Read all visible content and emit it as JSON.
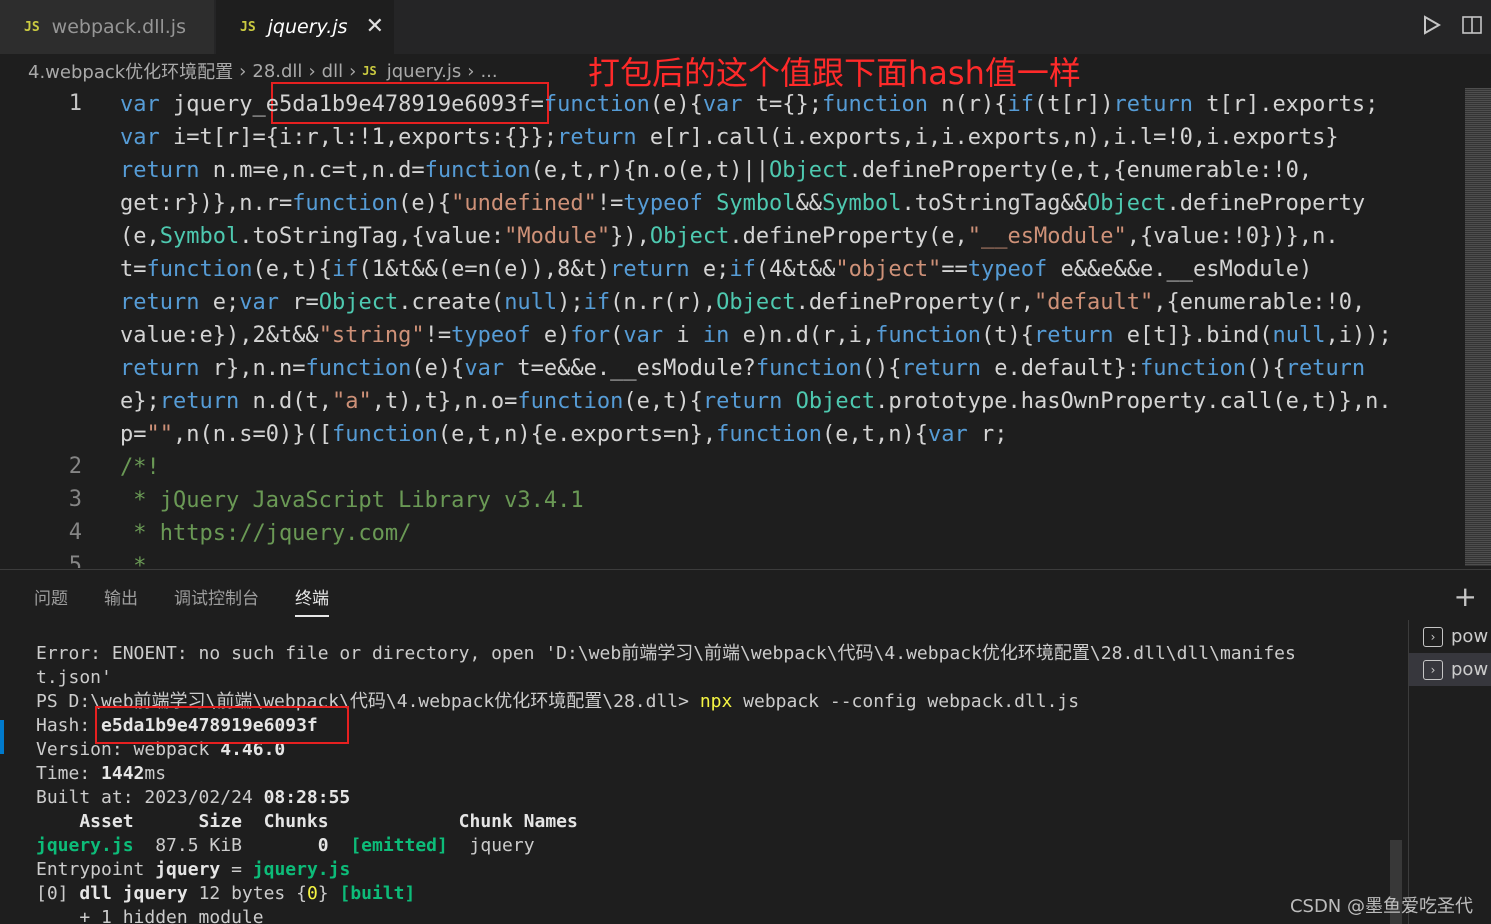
{
  "tabs": [
    {
      "icon": "JS",
      "label": "webpack.dll.js"
    },
    {
      "icon": "JS",
      "label": "jquery.js",
      "close": "✕"
    }
  ],
  "breadcrumb": [
    "4.webpack优化环境配置",
    "28.dll",
    "dll",
    "jquery.js",
    "..."
  ],
  "annotation": "打包后的这个值跟下面hash值一样",
  "editor": {
    "line_numbers": [
      "1",
      "2",
      "3",
      "4",
      "5"
    ],
    "line1": [
      "var jquery_e5da1b9e478919e6093f=function(e){var t={};function n(r){if(t[r])return t[r].exports;",
      "var i=t[r]={i:r,l:!1,exports:{}};return e[r].call(i.exports,i,i.exports,n),i.l=!0,i.exports}",
      "return n.m=e,n.c=t,n.d=function(e,t,r){n.o(e,t)||Object.defineProperty(e,t,{enumerable:!0,",
      "get:r})},n.r=function(e){\"undefined\"!=typeof Symbol&&Symbol.toStringTag&&Object.defineProperty",
      "(e,Symbol.toStringTag,{value:\"Module\"}),Object.defineProperty(e,\"__esModule\",{value:!0})},n.",
      "t=function(e,t){if(1&t&&(e=n(e)),8&t)return e;if(4&t&&\"object\"==typeof e&&e&&e.__esModule)",
      "return e;var r=Object.create(null);if(n.r(r),Object.defineProperty(r,\"default\",{enumerable:!0,",
      "value:e}),2&t&&\"string\"!=typeof e)for(var i in e)n.d(r,i,function(t){return e[t]}.bind(null,i));",
      "return r},n.n=function(e){var t=e&&e.__esModule?function(){return e.default}:function(){return",
      "e};return n.d(t,\"a\",t),t},n.o=function(e,t){return Object.prototype.hasOwnProperty.call(e,t)},n.",
      "p=\"\",n(n.s=0)}([function(e,t,n){e.exports=n},function(e,t,n){var r;"
    ],
    "line2": "/*!",
    "line3": " * jQuery JavaScript Library v3.4.1",
    "line4": " * https://jquery.com/",
    "line5": " *"
  },
  "panel": {
    "tabs": [
      "问题",
      "输出",
      "调试控制台",
      "终端"
    ],
    "active_tab": "终端",
    "plus": "+",
    "terminals": [
      "pow",
      "pow"
    ]
  },
  "terminal": {
    "error1": "Error: ENOENT: no such file or directory, open 'D:\\web前端学习\\前端\\webpack\\代码\\4.webpack优化环境配置\\28.dll\\dll\\manifes",
    "error2": "t.json'",
    "prompt": "PS D:\\web前端学习\\前端\\webpack\\代码\\4.webpack优化环境配置\\28.dll> ",
    "cmd_npx": "npx",
    "cmd_rest": " webpack --config webpack.dll.js",
    "hash_label": "Hash: ",
    "hash_value": "e5da1b9e478919e6093f",
    "version_label": "Version: webpack ",
    "version_value": "4.46.0",
    "time_label": "Time: ",
    "time_value": "1442",
    "time_unit": "ms",
    "built_label": "Built at: 2023/02/24 ",
    "built_time": "08:28:55",
    "table_header": "    Asset      Size  Chunks            Chunk Names",
    "asset_name": "jquery.js",
    "asset_size": "  87.5 KiB       ",
    "asset_chunk": "0",
    "asset_emitted": "[emitted]",
    "asset_chunkname": "  jquery",
    "entry_label": "Entrypoint ",
    "entry_name": "jquery",
    "entry_eq": " = ",
    "entry_file": "jquery.js",
    "dll_pre": "[0] ",
    "dll_name": "dll jquery",
    "dll_size": " 12 bytes {",
    "dll_id": "0",
    "dll_close": "} ",
    "dll_built": "[built]",
    "hidden": "    + 1 hidden module"
  },
  "watermark": "CSDN @墨鱼爱吃圣代"
}
